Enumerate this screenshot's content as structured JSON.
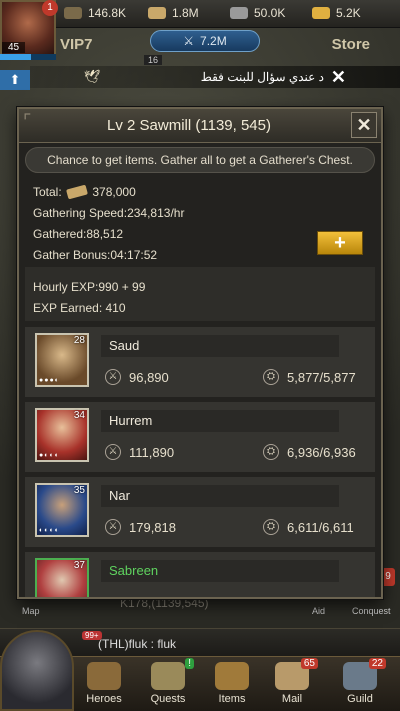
{
  "resources": {
    "player_badge": "1",
    "player_level": "45",
    "exp_fraction": 0.55,
    "food": "146.8K",
    "wood": "1.8M",
    "stone": "50.0K",
    "gold": "5.2K"
  },
  "header": {
    "vip": "VIP7",
    "power": "7.2M",
    "power_sub": "16",
    "store": "Store"
  },
  "announcement": {
    "text": "د عندي سؤال للبنت فقط"
  },
  "dialog": {
    "title": "Lv 2 Sawmill (1139, 545)",
    "hint": "Chance to get items. Gather all to get a Gatherer's Chest.",
    "total_label": "Total:",
    "total_value": "378,000",
    "gathering_speed": "Gathering Speed:234,813/hr",
    "gathered": "Gathered:88,512",
    "gather_bonus": "Gather Bonus:04:17:52",
    "plus_label": "+",
    "hourly_exp": "Hourly EXP:990 + 99",
    "exp_earned": "EXP Earned: 410"
  },
  "heroes": [
    {
      "name": "Saud",
      "level": "28",
      "troops": "96,890",
      "load": "5,877/5,877",
      "name_color": "#f0eadc"
    },
    {
      "name": "Hurrem",
      "level": "34",
      "troops": "111,890",
      "load": "6,936/6,936",
      "name_color": "#f0eadc"
    },
    {
      "name": "Nar",
      "level": "35",
      "troops": "179,818",
      "load": "6,611/6,611",
      "name_color": "#f0eadc"
    },
    {
      "name": "Sabreen",
      "level": "37",
      "troops": "",
      "load": "",
      "name_color": "#5fd35f"
    }
  ],
  "hud": {
    "map": "Map",
    "aid": "Aid",
    "conquest": "Conquest",
    "conquest_badge": "9",
    "coord_ghost": "K178,(1139,545)"
  },
  "chat": {
    "badge": "99+",
    "text": "(THL)fluk : fluk"
  },
  "tabs": [
    {
      "label": "Heroes",
      "badge": ""
    },
    {
      "label": "Quests",
      "badge": "!"
    },
    {
      "label": "Items",
      "badge": ""
    },
    {
      "label": "Mail",
      "badge": "65"
    },
    {
      "label": "Guild",
      "badge": "22"
    }
  ]
}
